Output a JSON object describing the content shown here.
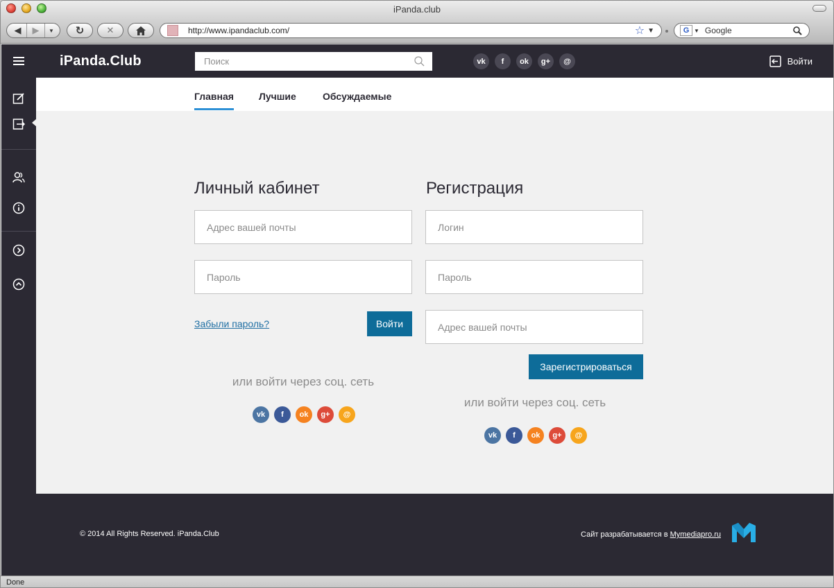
{
  "browser": {
    "window_title": "iPanda.club",
    "url": "http://www.ipandaclub.com/",
    "search_engine": "Google",
    "search_placeholder": "Google",
    "status": "Done"
  },
  "header": {
    "brand": "iPanda.Club",
    "search_placeholder": "Поиск",
    "social_icons": [
      "vk-icon",
      "facebook-icon",
      "odnoklassniki-icon",
      "google-plus-icon",
      "mailru-icon"
    ],
    "login_label": "Войти"
  },
  "sidebar": {
    "icons": [
      "edit-icon",
      "login-icon",
      "users-icon",
      "info-icon",
      "chevron-right-circle-icon",
      "chevron-up-circle-icon"
    ]
  },
  "tabs": [
    {
      "label": "Главная",
      "active": true
    },
    {
      "label": "Лучшие",
      "active": false
    },
    {
      "label": "Обсуждаемые",
      "active": false
    }
  ],
  "login": {
    "title": "Личный кабинет",
    "email_placeholder": "Адрес вашей почты",
    "password_placeholder": "Пароль",
    "forgot_label": "Забыли пароль?",
    "submit_label": "Войти",
    "social_caption": "или войти через соц. сеть"
  },
  "register": {
    "title": "Регистрация",
    "login_placeholder": "Логин",
    "password_placeholder": "Пароль",
    "email_placeholder": "Адрес вашей почты",
    "submit_label": "Зарегистрироваться",
    "social_caption": "или войти через соц. сеть"
  },
  "social_letters": {
    "vk": "vk",
    "fb": "f",
    "ok": "ok",
    "gp": "g+",
    "mail": "@"
  },
  "colors": {
    "dark": "#2b2933",
    "accent_blue": "#2d90d6",
    "button_blue": "#0e6c99",
    "vk": "#4c75a3",
    "facebook": "#3b5998",
    "odnoklassniki": "#f58220",
    "google_plus": "#dd4b39",
    "mailru": "#f7a51c"
  },
  "footer": {
    "copyright": "© 2014 All Rights Reserved. iPanda.Club",
    "dev_prefix": "Сайт разрабатывается в ",
    "dev_link": "Mymediapro.ru"
  }
}
